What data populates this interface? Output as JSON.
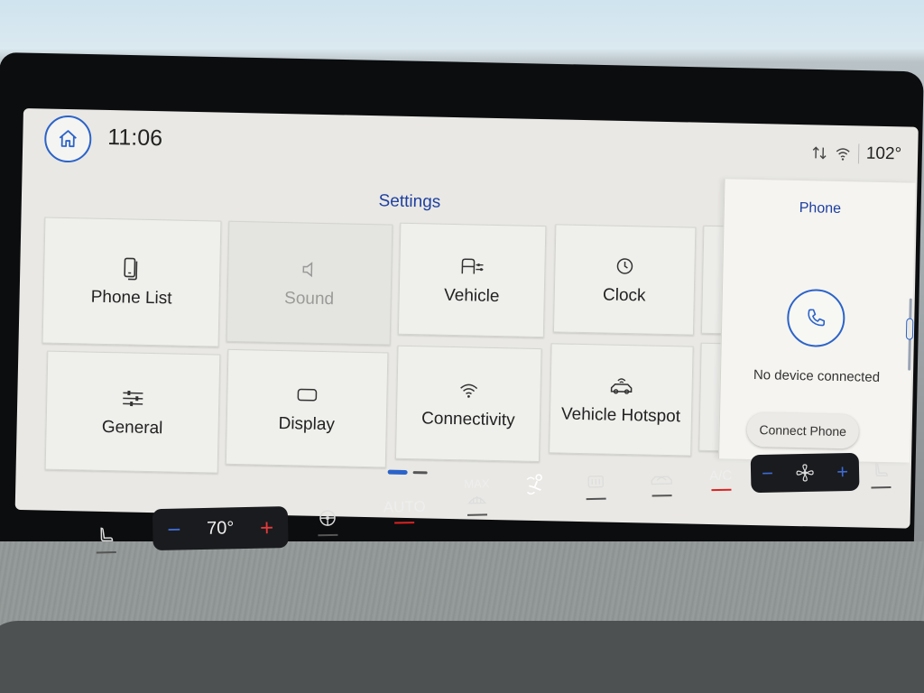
{
  "status": {
    "time": "11:06",
    "outside_temp": "102°"
  },
  "settings": {
    "title": "Settings",
    "tiles": [
      {
        "label": "Phone List",
        "icon": "phone-list-icon",
        "enabled": true
      },
      {
        "label": "Sound",
        "icon": "speaker-icon",
        "enabled": false
      },
      {
        "label": "Vehicle",
        "icon": "vehicle-settings-icon",
        "enabled": true
      },
      {
        "label": "Clock",
        "icon": "clock-icon",
        "enabled": true
      },
      {
        "label": "General",
        "icon": "sliders-icon",
        "enabled": true
      },
      {
        "label": "Display",
        "icon": "display-icon",
        "enabled": true
      },
      {
        "label": "Connectivity",
        "icon": "wifi-icon",
        "enabled": true
      },
      {
        "label": "Vehicle Hotspot",
        "icon": "car-wifi-icon",
        "enabled": true
      }
    ],
    "page_count": 2,
    "current_page": 1
  },
  "phone_panel": {
    "title": "Phone",
    "status": "No device connected",
    "connect_label": "Connect Phone"
  },
  "climate": {
    "driver_temp": "70°",
    "auto_label": "AUTO",
    "max_defrost_label": "MAX",
    "ac_label": "A/C"
  },
  "colors": {
    "accent": "#2b63c9",
    "title_blue": "#1d3fa0",
    "temp_up": "#e23a3a",
    "temp_down": "#3d6bd6"
  }
}
